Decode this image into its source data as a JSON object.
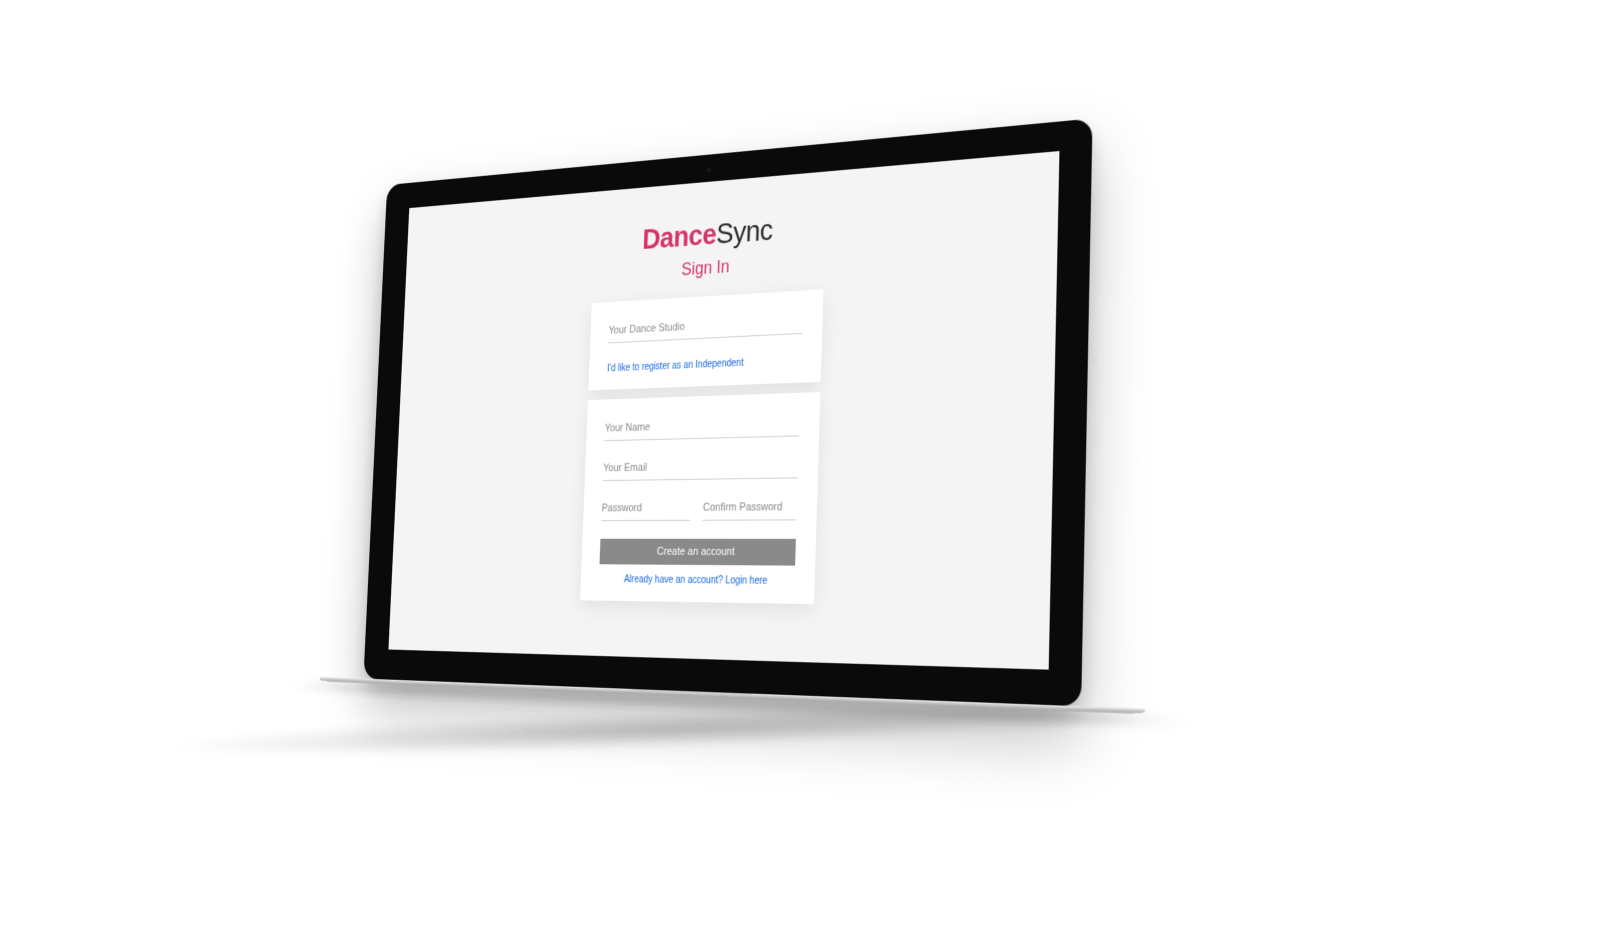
{
  "logo": {
    "part1": "Dance",
    "part2": "Sync"
  },
  "subtitle": "Sign In",
  "form": {
    "studio_placeholder": "Your Dance Studio",
    "independent_link": "I'd like to register as an Independent",
    "name_placeholder": "Your Name",
    "email_placeholder": "Your Email",
    "password_placeholder": "Password",
    "confirm_placeholder": "Confirm Password",
    "submit_label": "Create an account",
    "login_link": "Already have an account? Login here"
  }
}
